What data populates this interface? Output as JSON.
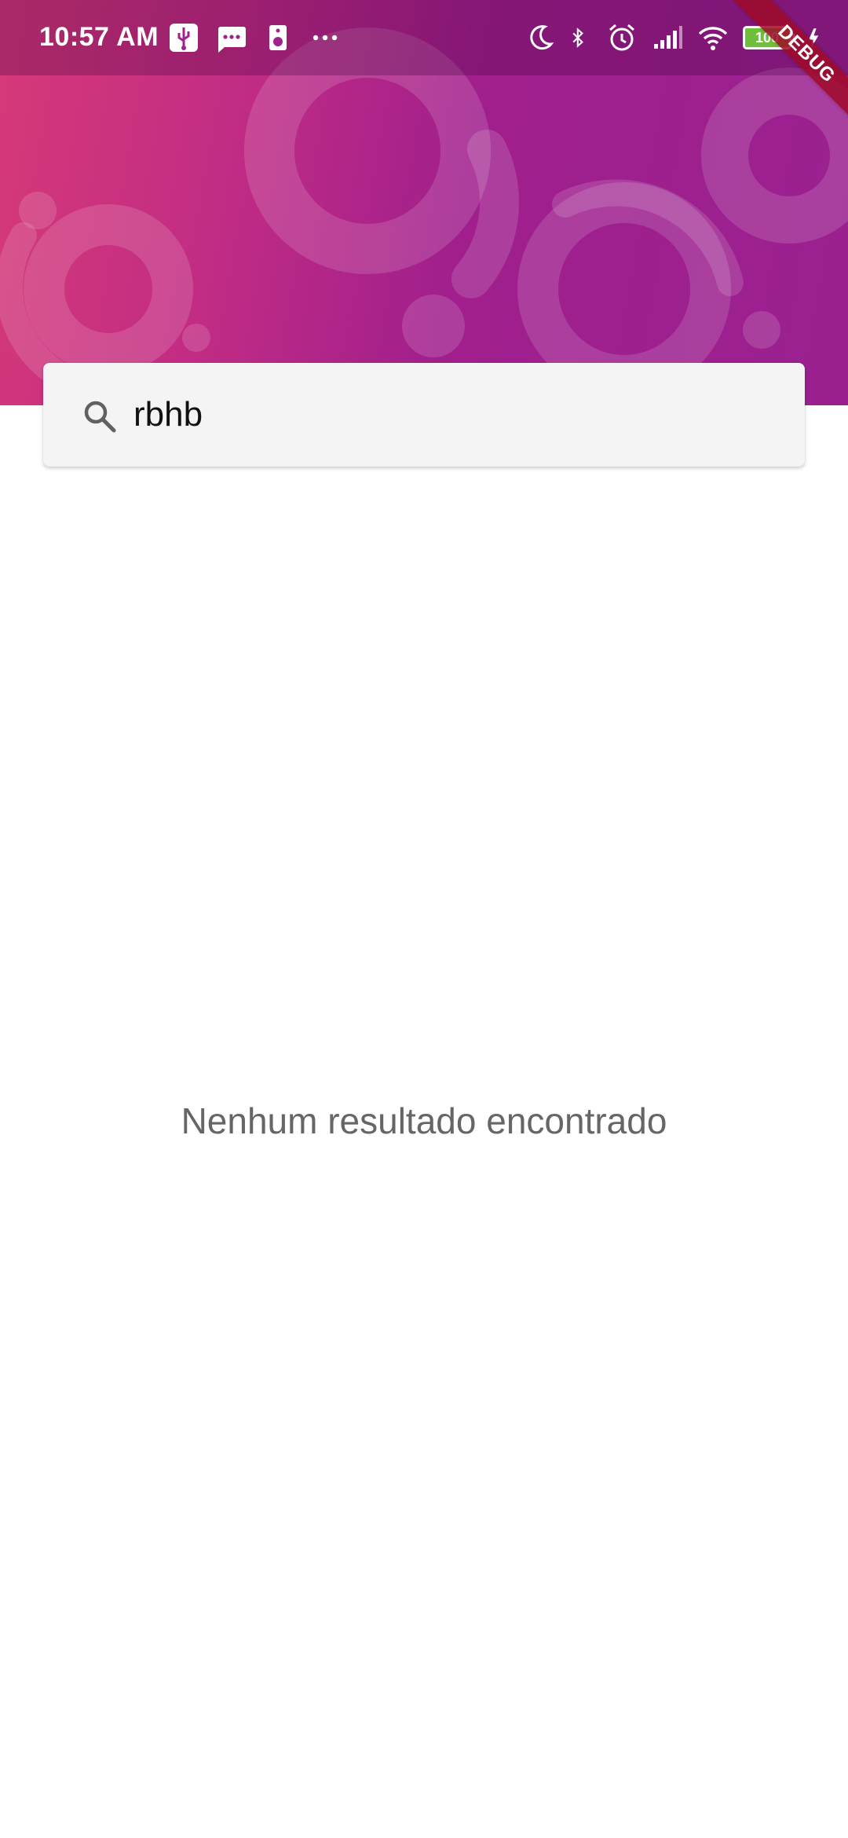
{
  "status_bar": {
    "time": "10:57 AM",
    "battery_level": "100",
    "left_icons": [
      "usb-icon",
      "message-icon",
      "speaker-icon",
      "more-dots-icon"
    ],
    "right_icons": [
      "moon-icon",
      "bluetooth-icon",
      "alarm-icon",
      "signal-icon",
      "wifi-icon",
      "battery-icon",
      "charging-icon"
    ]
  },
  "debug_banner": "DEBUG",
  "search": {
    "value": "rbhb",
    "placeholder": ""
  },
  "empty_state": {
    "message": "Nenhum resultado encontrado"
  },
  "colors": {
    "header_gradient_start": "#d63a78",
    "header_gradient_end": "#9a2090",
    "search_background": "#f4f4f4",
    "empty_text": "#666666"
  }
}
